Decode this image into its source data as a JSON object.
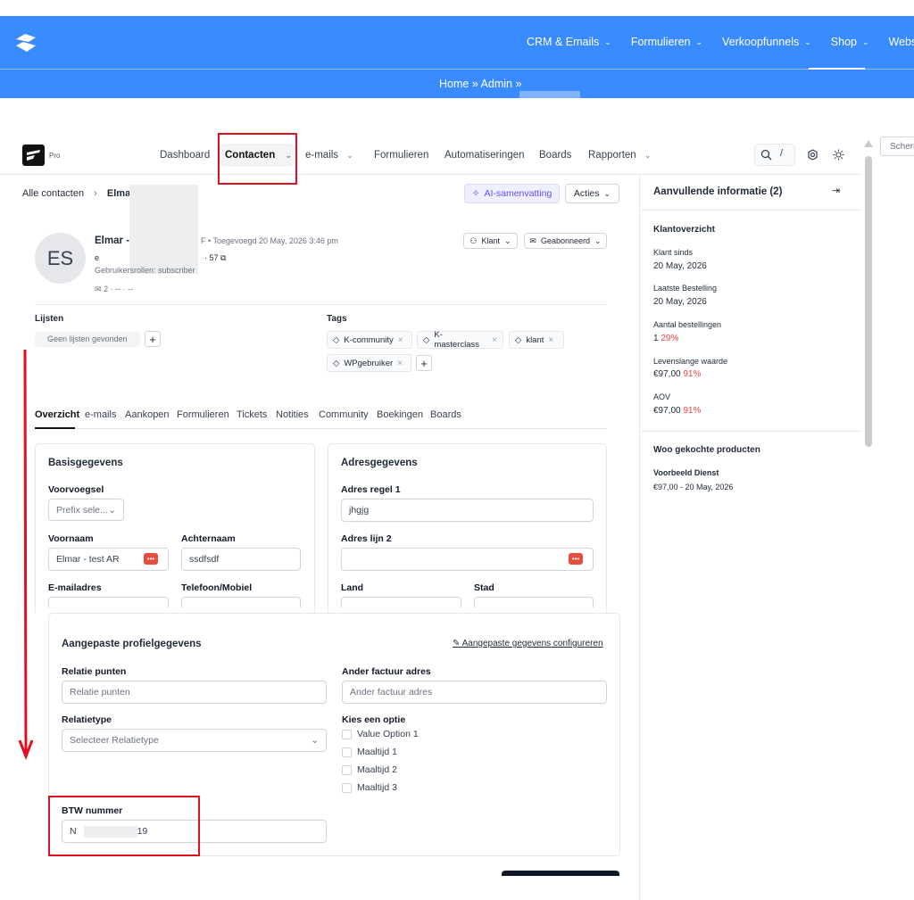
{
  "topbar": {
    "nav": [
      "CRM & Emails",
      "Formulieren",
      "Verkoopfunnels",
      "Shop",
      "Website"
    ],
    "breadcrumb": "Home » Admin »"
  },
  "appnav": {
    "badge": "Pro",
    "menu": [
      "Dashboard",
      "Contacten",
      "e-mails",
      "Formulieren",
      "Automatiseringen",
      "Boards",
      "Rapporten"
    ],
    "search_shortcut": "/"
  },
  "side_label": "Scherm",
  "contact": {
    "crumb_root": "Alle contacten",
    "crumb_name": "Elmar -",
    "ai_summary": "AI-samenvatting",
    "actions": "Acties",
    "initials": "ES",
    "name": "Elmar -",
    "added": "Toegevoegd 20 May, 2026 3:46 pm",
    "email_fragment_start": "e",
    "email_fragment_end": "57",
    "roles": "Gebruikersrollen: subscriber",
    "stats": "2 ·     -- ·     --",
    "type_btn": "Klant",
    "status_btn": "Geabonneerd"
  },
  "lists": {
    "title": "Lijsten",
    "empty": "Geen lijsten gevonden"
  },
  "tags": {
    "title": "Tags",
    "items": [
      "K-community",
      "K-masterclass",
      "klant",
      "WPgebruiker"
    ]
  },
  "tabs": [
    "Overzicht",
    "e-mails",
    "Aankopen",
    "Formulieren",
    "Tickets",
    "Notities",
    "Community",
    "Boekingen",
    "Boards"
  ],
  "basic": {
    "title": "Basisgegevens",
    "prefix_label": "Voorvoegsel",
    "prefix_placeholder": "Prefix sele...",
    "first_label": "Voornaam",
    "first_value": "Elmar - test AR",
    "last_label": "Achternaam",
    "last_value": "ssdfsdf",
    "email_label": "E-mailadres",
    "phone_label": "Telefoon/Mobiel"
  },
  "address": {
    "title": "Adresgegevens",
    "line1_label": "Adres regel 1",
    "line1_value": "jhgjg",
    "line2_label": "Adres lijn 2",
    "country_label": "Land",
    "city_label": "Stad"
  },
  "custom": {
    "title": "Aangepaste profielgegevens",
    "configure": "Aangepaste gegevens configureren",
    "points_label": "Relatie punten",
    "points_placeholder": "Relatie punten",
    "invoice_label": "Ander factuur adres",
    "invoice_placeholder": "Ander factuur adres",
    "type_label": "Relatietype",
    "type_placeholder": "Selecteer Relatietype",
    "option_label": "Kies een optie",
    "options": [
      "Value Option 1",
      "Maaltijd 1",
      "Maaltijd 2",
      "Maaltijd 3"
    ],
    "vat_label": "BTW nummer",
    "vat_start": "N",
    "vat_end": "19"
  },
  "info": {
    "title": "Aanvullende informatie (2)",
    "overview": "Klantoverzicht",
    "since_label": "Klant sinds",
    "since_value": "20 May, 2026",
    "last_label": "Laatste Bestelling",
    "last_value": "20 May, 2026",
    "orders_label": "Aantal bestellingen",
    "orders_value": "1",
    "orders_pct": "29%",
    "ltv_label": "Levenslange waarde",
    "ltv_value": "€97,00",
    "ltv_pct": "91%",
    "aov_label": "AOV",
    "aov_value": "€97,00",
    "aov_pct": "91%",
    "products_title": "Woo gekochte producten",
    "product_name": "Voorbeeld Dienst",
    "product_meta": "€97,00 - 20 May, 2026"
  }
}
